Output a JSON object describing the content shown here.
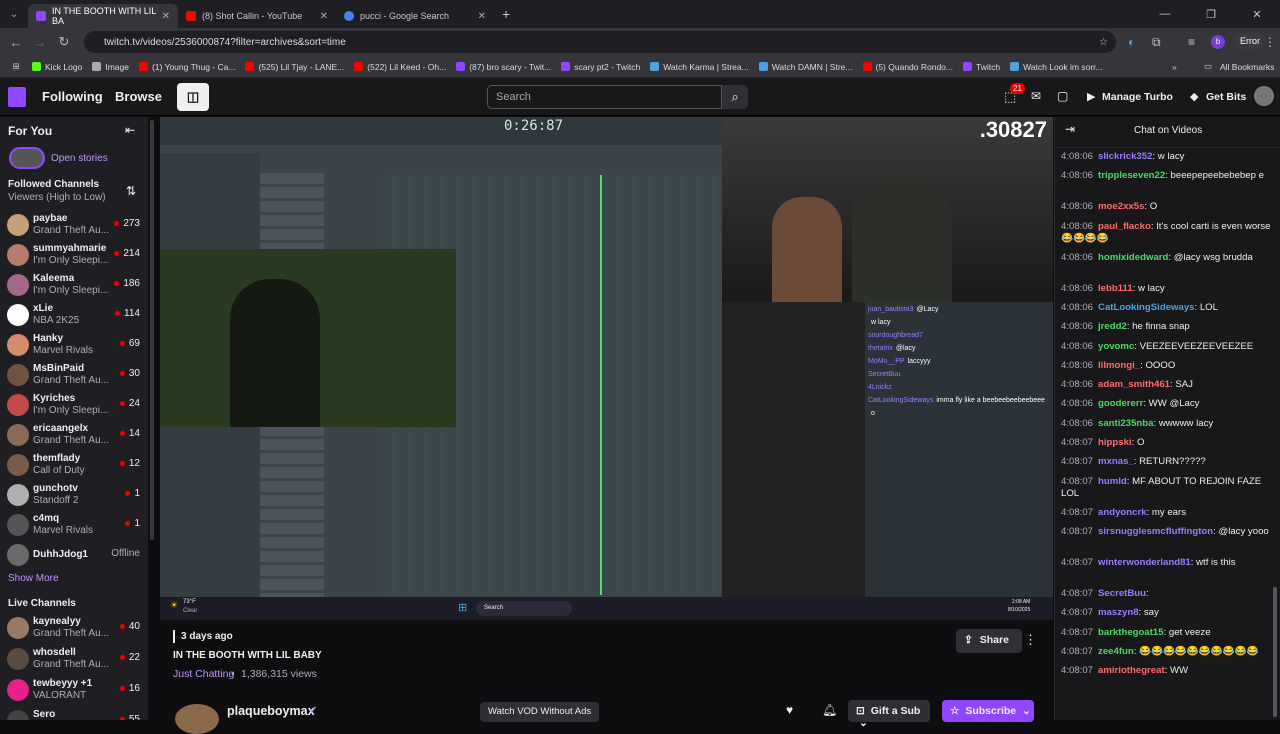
{
  "browser": {
    "tabs": [
      {
        "title": "IN THE BOOTH WITH LIL BA",
        "fav": "#9147ff"
      },
      {
        "title": "(8) Shot Callin - YouTube",
        "fav": "#ff0000"
      },
      {
        "title": "pucci - Google Search",
        "fav": "#4285f4"
      }
    ],
    "new_tab": "+",
    "url": "twitch.tv/videos/2536000874?filter=archives&sort=time",
    "error_label": "Error",
    "bookmarks": [
      {
        "label": "Kick Logo",
        "color": "#53fc18"
      },
      {
        "label": "Image",
        "color": "#aaaaaa"
      },
      {
        "label": "(1) Young Thug - Ca...",
        "color": "#ff0000"
      },
      {
        "label": "(525) Lil Tjay - LANE...",
        "color": "#ff0000"
      },
      {
        "label": "(522) Lil Keed - Oh...",
        "color": "#ff0000"
      },
      {
        "label": "(87) bro scary - Twit...",
        "color": "#9147ff"
      },
      {
        "label": "scary pt2 - Twitch",
        "color": "#9147ff"
      },
      {
        "label": "Watch Karma | Strea...",
        "color": "#4aa3df"
      },
      {
        "label": "Watch DAMN | Stre...",
        "color": "#4aa3df"
      },
      {
        "label": "(5) Quando Rondo...",
        "color": "#ff0000"
      },
      {
        "label": "Twitch",
        "color": "#9147ff"
      },
      {
        "label": "Watch Look im sorr...",
        "color": "#4aa3df"
      }
    ],
    "all_bookmarks": "All Bookmarks"
  },
  "topnav": {
    "following": "Following",
    "browse": "Browse",
    "search_placeholder": "Search",
    "notif_count": "21",
    "manage_turbo": "Manage Turbo",
    "get_bits": "Get Bits"
  },
  "sidebar": {
    "for_you": "For You",
    "open_stories": "Open stories",
    "followed_channels": "Followed Channels",
    "sort": "Viewers (High to Low)",
    "channels": [
      {
        "name": "paybae",
        "game": "Grand Theft Au...",
        "viewers": "273",
        "color": "#c7a07a"
      },
      {
        "name": "summyahmarie",
        "game": "I'm Only Sleepi...",
        "viewers": "214",
        "color": "#b57b6c"
      },
      {
        "name": "Kaleema",
        "game": "I'm Only Sleepi...",
        "viewers": "186",
        "color": "#a3698a"
      },
      {
        "name": "xLie",
        "game": "NBA 2K25",
        "viewers": "114",
        "color": "#ffffff"
      },
      {
        "name": "Hanky",
        "game": "Marvel Rivals",
        "viewers": "69",
        "color": "#d48b6e"
      },
      {
        "name": "MsBinPaid",
        "game": "Grand Theft Au...",
        "viewers": "30",
        "color": "#6f5442"
      },
      {
        "name": "Kyriches",
        "game": "I'm Only Sleepi...",
        "viewers": "24",
        "color": "#c44a4a"
      },
      {
        "name": "ericaangelx",
        "game": "Grand Theft Au...",
        "viewers": "14",
        "color": "#8a6a58"
      },
      {
        "name": "themfladу",
        "game": "Call of Duty",
        "viewers": "12",
        "color": "#7a5a48"
      },
      {
        "name": "gunchotv",
        "game": "Standoff 2",
        "viewers": "1",
        "color": "#b0b0b0"
      },
      {
        "name": "c4mq",
        "game": "Marvel Rivals",
        "viewers": "1",
        "color": "#555555"
      },
      {
        "name": "DuhhJdog1",
        "game": "",
        "viewers": "Offline",
        "color": "#6a6a6a"
      }
    ],
    "show_more": "Show More",
    "live_channels": "Live Channels",
    "live": [
      {
        "name": "kaynealyy",
        "game": "Grand Theft Au...",
        "viewers": "40",
        "color": "#9a7a66"
      },
      {
        "name": "whosdell",
        "game": "Grand Theft Au...",
        "viewers": "22",
        "color": "#5a4a40"
      },
      {
        "name": "tewbeyyy +1",
        "game": "VALORANT",
        "viewers": "16",
        "color": "#e91e8c"
      },
      {
        "name": "Sero",
        "game": "",
        "viewers": "55",
        "color": "#444444"
      }
    ]
  },
  "video": {
    "timer": "0:26:87",
    "counter": ".30827",
    "overlay_chat": [
      {
        "user": "juan_bautista3",
        "text": "@Lacy"
      },
      {
        "user": "",
        "text": "w lacy"
      },
      {
        "user": "sourdoughbread7",
        "text": ""
      },
      {
        "user": "thetatrix",
        "text": "@lacy"
      },
      {
        "user": "MoMo__PP",
        "text": "laccyyy"
      },
      {
        "user": "SecretBuu",
        "text": ""
      },
      {
        "user": "4Lnickz",
        "text": ""
      },
      {
        "user": "CatLookingSideways",
        "text": "imma fly like a beebeebeebeebeee"
      },
      {
        "user": "",
        "text": "o"
      }
    ],
    "taskbar_search": "Search",
    "weather": "73°F",
    "weather_sub": "Clear",
    "clock": "2:08 AM",
    "date": "8/10/2025"
  },
  "info": {
    "ago": "3 days ago",
    "title": "IN THE BOOTH WITH LIL BABY",
    "category": "Just Chatting",
    "views": "1,386,315 views",
    "share": "Share",
    "channel": "plaqueboymax",
    "watch_vod": "Watch VOD Without Ads",
    "gift": "Gift a Sub",
    "subscribe": "Subscribe"
  },
  "chat": {
    "title": "Chat on Videos",
    "messages": [
      {
        "time": "4:08:06",
        "user": "slickrick352",
        "color": "#9b7bff",
        "text": ": w lacy"
      },
      {
        "time": "4:08:06",
        "user": "trippleseven22",
        "color": "#4cd964",
        "text": ": beeepepeebebebep e"
      },
      {
        "time": "4:08:06",
        "user": "moe2xx5s",
        "color": "#ff6b6b",
        "text": ": O"
      },
      {
        "time": "4:08:06",
        "user": "paul_flacko",
        "color": "#ff6b6b",
        "text": ": It's cool carti is even worse 😂😂😂😂"
      },
      {
        "time": "4:08:06",
        "user": "homixidedward",
        "color": "#4cd964",
        "text": ": @lacy wsg brudda"
      },
      {
        "time": "4:08:06",
        "user": "lebb111",
        "color": "#ff6b6b",
        "text": ": w lacy"
      },
      {
        "time": "4:08:06",
        "user": "CatLookingSideways",
        "color": "#4aa3df",
        "text": ": LOL"
      },
      {
        "time": "4:08:06",
        "user": "jredd2",
        "color": "#4cd964",
        "text": ": he finna snap"
      },
      {
        "time": "4:08:06",
        "user": "yovomc",
        "color": "#4cd964",
        "text": ": VEEZEEVEEZEEVEEZEE"
      },
      {
        "time": "4:08:06",
        "user": "lilmongi_",
        "color": "#ff6b6b",
        "text": ": OOOO"
      },
      {
        "time": "4:08:06",
        "user": "adam_smith461",
        "color": "#ff6b6b",
        "text": ": SAJ"
      },
      {
        "time": "4:08:06",
        "user": "goodererr",
        "color": "#4cd964",
        "text": ": WW @Lacy"
      },
      {
        "time": "4:08:06",
        "user": "santi235nba",
        "color": "#4cd964",
        "text": ": wwwww lacy"
      },
      {
        "time": "4:08:07",
        "user": "hippski",
        "color": "#ff6b6b",
        "text": ": O"
      },
      {
        "time": "4:08:07",
        "user": "mxnas_",
        "color": "#9b7bff",
        "text": ": RETURN?????"
      },
      {
        "time": "4:08:07",
        "user": "humld",
        "color": "#9b7bff",
        "text": ": MF ABOUT TO REJOIN FAZE LOL"
      },
      {
        "time": "4:08:07",
        "user": "andyoncrk",
        "color": "#9b7bff",
        "text": ": my ears"
      },
      {
        "time": "4:08:07",
        "user": "sirsnugglesmcfluffington",
        "color": "#9b7bff",
        "text": ": @lacy yooo"
      },
      {
        "time": "4:08:07",
        "user": "winterwonderland81",
        "color": "#9b7bff",
        "text": ": wtf is this"
      },
      {
        "time": "4:08:07",
        "user": "SecretBuu",
        "color": "#9b7bff",
        "text": ":"
      },
      {
        "time": "4:08:07",
        "user": "maszyn8",
        "color": "#9b7bff",
        "text": ": say"
      },
      {
        "time": "4:08:07",
        "user": "barkthegoat15",
        "color": "#4cd964",
        "text": ": get veeze"
      },
      {
        "time": "4:08:07",
        "user": "zee4fun",
        "color": "#4cd964",
        "text": ": 😂😂😂😂😂😂😂😂😂😂"
      },
      {
        "time": "4:08:07",
        "user": "amiriothegreat",
        "color": "#ff6b6b",
        "text": ": WW"
      }
    ]
  }
}
